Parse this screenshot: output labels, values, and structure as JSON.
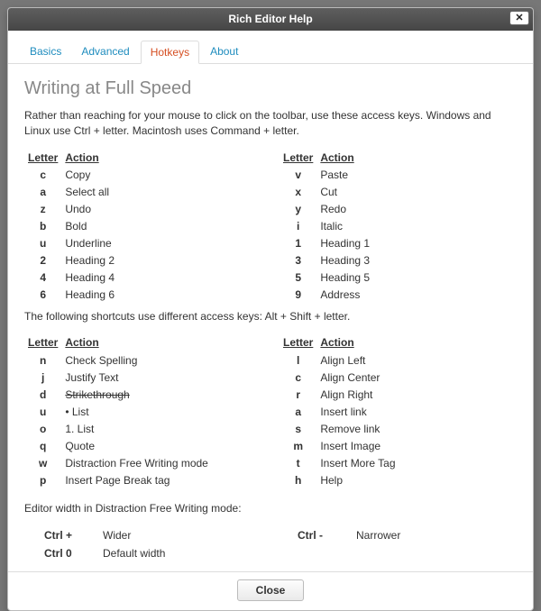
{
  "dialog": {
    "title": "Rich Editor Help"
  },
  "tabs": [
    {
      "label": "Basics",
      "active": false
    },
    {
      "label": "Advanced",
      "active": false
    },
    {
      "label": "Hotkeys",
      "active": true
    },
    {
      "label": "About",
      "active": false
    }
  ],
  "page": {
    "heading": "Writing at Full Speed",
    "intro": "Rather than reaching for your mouse to click on the toolbar, use these access keys. Windows and Linux use Ctrl + letter. Macintosh uses Command + letter.",
    "col_headers": {
      "letter": "Letter",
      "action": "Action"
    },
    "ctrl_left": [
      {
        "letter": "c",
        "action": "Copy"
      },
      {
        "letter": "a",
        "action": "Select all"
      },
      {
        "letter": "z",
        "action": "Undo"
      },
      {
        "letter": "b",
        "action": "Bold"
      },
      {
        "letter": "u",
        "action": "Underline"
      },
      {
        "letter": "2",
        "action": "Heading 2"
      },
      {
        "letter": "4",
        "action": "Heading 4"
      },
      {
        "letter": "6",
        "action": "Heading 6"
      }
    ],
    "ctrl_right": [
      {
        "letter": "v",
        "action": "Paste"
      },
      {
        "letter": "x",
        "action": "Cut"
      },
      {
        "letter": "y",
        "action": "Redo"
      },
      {
        "letter": "i",
        "action": "Italic"
      },
      {
        "letter": "1",
        "action": "Heading 1"
      },
      {
        "letter": "3",
        "action": "Heading 3"
      },
      {
        "letter": "5",
        "action": "Heading 5"
      },
      {
        "letter": "9",
        "action": "Address"
      }
    ],
    "alt_note": "The following shortcuts use different access keys: Alt + Shift + letter.",
    "alt_left": [
      {
        "letter": "n",
        "action": "Check Spelling"
      },
      {
        "letter": "j",
        "action": "Justify Text"
      },
      {
        "letter": "d",
        "action": "Strikethrough",
        "strike": true
      },
      {
        "letter": "u",
        "action": "• List"
      },
      {
        "letter": "o",
        "action": "1. List"
      },
      {
        "letter": "q",
        "action": "Quote"
      },
      {
        "letter": "w",
        "action": "Distraction Free Writing mode"
      },
      {
        "letter": "p",
        "action": "Insert Page Break tag"
      }
    ],
    "alt_right": [
      {
        "letter": "l",
        "action": "Align Left"
      },
      {
        "letter": "c",
        "action": "Align Center"
      },
      {
        "letter": "r",
        "action": "Align Right"
      },
      {
        "letter": "a",
        "action": "Insert link"
      },
      {
        "letter": "s",
        "action": "Remove link"
      },
      {
        "letter": "m",
        "action": "Insert Image"
      },
      {
        "letter": "t",
        "action": "Insert More Tag"
      },
      {
        "letter": "h",
        "action": "Help"
      }
    ],
    "width_note": "Editor width in Distraction Free Writing mode:",
    "width_rows": [
      [
        {
          "key": "Ctrl +",
          "action": "Wider"
        },
        {
          "key": "Ctrl -",
          "action": "Narrower"
        }
      ],
      [
        {
          "key": "Ctrl 0",
          "action": "Default width"
        }
      ]
    ]
  },
  "footer": {
    "close_label": "Close"
  }
}
